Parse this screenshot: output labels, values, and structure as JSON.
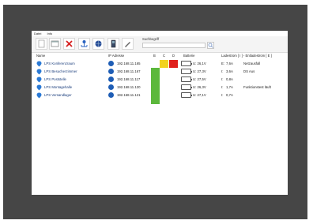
{
  "menu": {
    "file": "Datei",
    "info": "Info"
  },
  "search": {
    "label": "Suchbegriff",
    "value": ""
  },
  "columns": {
    "name": "Name",
    "ip": "IP Adresse",
    "b": "B",
    "c": "C",
    "d": "D",
    "battery": "Batterie",
    "current": "Ladestrom [ I ] - Entladestrom [ E ]"
  },
  "rows": [
    {
      "name": "LPS Konferenzraum",
      "ip": "192.168.11.165",
      "u": "U: 26,1V",
      "i": "E:",
      "a": "7,6A",
      "status": "Netzausfall"
    },
    {
      "name": "LPS Besucherzimmer",
      "ip": "192.168.11.167",
      "u": "U: 27,3V",
      "i": "I:",
      "a": "3,6A",
      "status": "DS Aus"
    },
    {
      "name": "LPS Poststelle",
      "ip": "192.168.11.117",
      "u": "U: 27,5V",
      "i": "I:",
      "a": "0,8A",
      "status": ""
    },
    {
      "name": "LPS Montagehalle",
      "ip": "192.168.11.120",
      "u": "U: 26,3V",
      "i": "I:",
      "a": "1,7A",
      "status": "Funktionstest läuft"
    },
    {
      "name": "LPS Versandlager",
      "ip": "192.168.11.121",
      "u": "U: 27,1V",
      "i": "I:",
      "a": "0,7A",
      "status": ""
    }
  ],
  "icons": [
    "new-icon",
    "window-icon",
    "delete-icon",
    "network-icon",
    "globe-icon",
    "device-icon",
    "edit-icon",
    "search-icon",
    "location-pin-icon",
    "battery-icon"
  ]
}
